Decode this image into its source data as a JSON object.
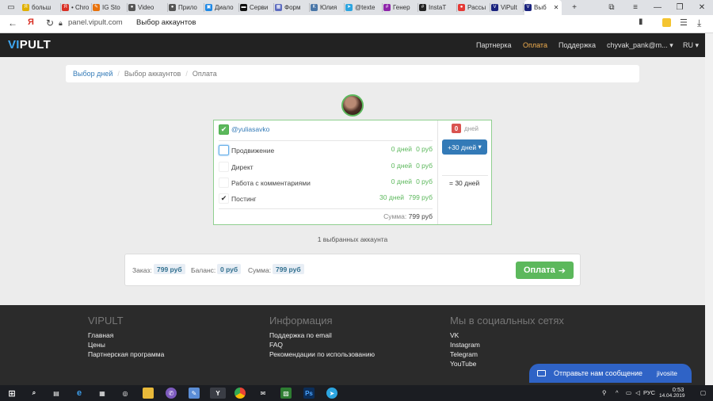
{
  "browser": {
    "tabs": [
      {
        "label": "больш",
        "color": "#e0b000",
        "letter": "Я"
      },
      {
        "label": "• Chro",
        "color": "#d93025",
        "letter": "Я"
      },
      {
        "label": "IG Sto",
        "color": "#e8710a",
        "letter": "✎"
      },
      {
        "label": "Video",
        "color": "#555555",
        "letter": "●"
      },
      {
        "label": "Прило",
        "color": "#555555",
        "letter": "●"
      },
      {
        "label": "Диало",
        "color": "#1e88e5",
        "letter": "▣"
      },
      {
        "label": "Серви",
        "color": "#111111",
        "letter": "▬"
      },
      {
        "label": "Форм",
        "color": "#5c6bc0",
        "letter": "▦"
      },
      {
        "label": "Юлия",
        "color": "#4a76a8",
        "letter": "K"
      },
      {
        "label": "@texte",
        "color": "#2ca5e0",
        "letter": "➤"
      },
      {
        "label": "Генер",
        "color": "#8e24aa",
        "letter": "#"
      },
      {
        "label": "InstaT",
        "color": "#222222",
        "letter": "#"
      },
      {
        "label": "Рассы",
        "color": "#e53935",
        "letter": "●"
      },
      {
        "label": "ViPult",
        "color": "#1a237e",
        "letter": "V"
      },
      {
        "label": "Выб",
        "color": "#1a237e",
        "letter": "V"
      }
    ],
    "url": "panel.vipult.com",
    "page_title": "Выбор аккаунтов",
    "new_tab": "+"
  },
  "site": {
    "logo_vi": "VI",
    "logo_pult": "PULT",
    "nav": {
      "partner": "Партнерка",
      "payment": "Оплата",
      "support": "Поддержка",
      "user": "chyvak_pank@m...",
      "lang": "RU"
    },
    "colors": {
      "accent": "#f0ad4e",
      "green": "#5cb85c",
      "blue": "#337ab7",
      "red": "#d9534f"
    }
  },
  "breadcrumb": {
    "step1": "Выбор дней",
    "step2": "Выбор аккаунтов",
    "current": "Оплата"
  },
  "account": {
    "username": "@yuliasavko",
    "days_badge": "0",
    "days_label": "дней",
    "add_days_button": "+30 дней",
    "total_days": "= 30 дней",
    "services": [
      {
        "name": "Продвижение",
        "days": "0 дней",
        "price": "0 руб",
        "checked": false
      },
      {
        "name": "Директ",
        "days": "0 дней",
        "price": "0 руб",
        "checked": false
      },
      {
        "name": "Работа с комментариями",
        "days": "0 дней",
        "price": "0 руб",
        "checked": false
      },
      {
        "name": "Постинг",
        "days": "30 дней",
        "price": "799 руб",
        "checked": true
      }
    ],
    "sum_label": "Сумма:",
    "sum_value": "799 руб"
  },
  "selected_count": "1 выбранных аккаунта",
  "order": {
    "order_label": "Заказ:",
    "order_value": "799 руб",
    "balance_label": "Баланс:",
    "balance_value": "0 руб",
    "sum_label": "Сумма:",
    "sum_value": "799 руб",
    "pay_button": "Оплата"
  },
  "footer": {
    "col1": {
      "title": "VIPULT",
      "links": [
        "Главная",
        "Цены",
        "Партнерская программа"
      ]
    },
    "col2": {
      "title": "Информация",
      "links": [
        "Поддержка по email",
        "FAQ",
        "Рекомендации по использованию"
      ]
    },
    "col3": {
      "title": "Мы в социальных сетях",
      "links": [
        "VK",
        "Instagram",
        "Telegram",
        "YouTube"
      ]
    }
  },
  "chat_widget": {
    "label": "Отправьте нам сообщение",
    "brand": "jivosite"
  },
  "taskbar": {
    "lang": "РУС",
    "time": "0:53",
    "date": "14.04.2019"
  }
}
